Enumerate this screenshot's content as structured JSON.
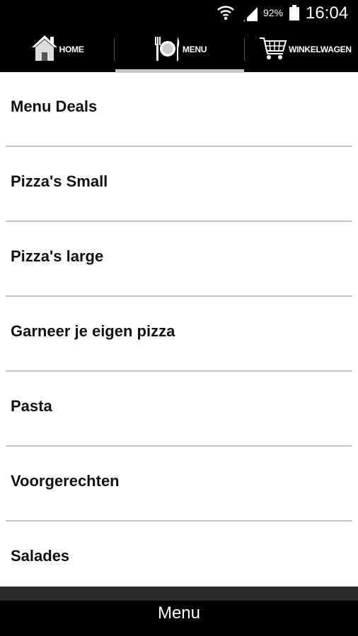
{
  "status_bar": {
    "battery_percent": "92%",
    "time": "16:04",
    "icons": [
      "wifi-icon",
      "cell-signal-icon",
      "battery-icon"
    ]
  },
  "tabs": [
    {
      "label": "HOME",
      "icon": "house-icon",
      "selected": false
    },
    {
      "label": "MENU",
      "icon": "plate-cutlery-icon",
      "selected": true
    },
    {
      "label": "WINKELWAGEN",
      "icon": "shopping-cart-icon",
      "selected": false
    }
  ],
  "menu_items": [
    {
      "label": "Menu Deals"
    },
    {
      "label": "Pizza's Small"
    },
    {
      "label": "Pizza's large"
    },
    {
      "label": "Garneer je eigen pizza"
    },
    {
      "label": "Pasta"
    },
    {
      "label": "Voorgerechten"
    },
    {
      "label": "Salades"
    }
  ],
  "bottom_bar": {
    "title": "Menu"
  },
  "colors": {
    "bar_background": "#000000",
    "divider": "#c4c4c4",
    "tab_indicator": "#c8c8c8",
    "text": "#111111"
  }
}
